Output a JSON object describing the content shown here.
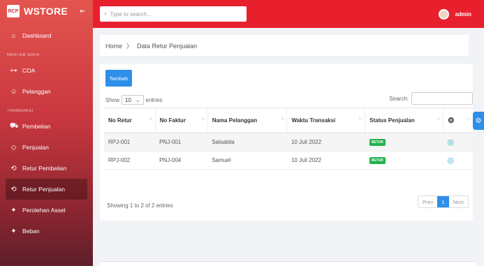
{
  "brand": {
    "logo_text": "RCP",
    "title": "WSTORE",
    "collapse_icon": "collapse-icon"
  },
  "sidebar": {
    "items_top": [
      {
        "label": "Dashboard",
        "icon": "home-icon"
      }
    ],
    "section_master": "MASTER DATA",
    "items_master": [
      {
        "label": "COA",
        "icon": "key-icon"
      },
      {
        "label": "Pelanggan",
        "icon": "user-add-icon"
      }
    ],
    "section_transaksi": "TRANSAKSI",
    "items_transaksi": [
      {
        "label": "Pembelian",
        "icon": "cart-icon"
      },
      {
        "label": "Penjualan",
        "icon": "tag-icon"
      },
      {
        "label": "Retur Pembelian",
        "icon": "return-icon"
      },
      {
        "label": "Retur Penjualan",
        "icon": "return-icon",
        "active": true
      },
      {
        "label": "Perolehan Asset",
        "icon": "asset-icon"
      },
      {
        "label": "Beban",
        "icon": "asset-icon"
      }
    ]
  },
  "topbar": {
    "search_placeholder": "Type to search...",
    "user_name": "admin"
  },
  "breadcrumb": {
    "home": "Home",
    "separator": "〉",
    "current": "Data Retur Penjualan"
  },
  "card": {
    "add_button": "Tambah",
    "show_label": "Show",
    "show_value": "10",
    "entries_label": "entries",
    "search_label": "Search:",
    "columns": [
      "No Retur",
      "No Faktur",
      "Nama Pelanggan",
      "Waktu Transaksi",
      "Status Penjualan"
    ],
    "rows": [
      {
        "no_retur": "RPJ-001",
        "no_faktur": "PNJ-001",
        "nama": "Salsabila",
        "waktu": "10 Juli 2022",
        "status": "RETUR"
      },
      {
        "no_retur": "RPJ-002",
        "no_faktur": "PNJ-004",
        "nama": "Samuel",
        "waktu": "10 Juli 2022",
        "status": "RETUR"
      }
    ],
    "info": "Showing 1 to 2 of 2 entries",
    "pager": {
      "prev": "Prev",
      "current": "1",
      "next": "Next"
    }
  },
  "colors": {
    "accent_red": "#e8202e",
    "primary_blue": "#2e8fe8",
    "status_green": "#22b14c"
  }
}
